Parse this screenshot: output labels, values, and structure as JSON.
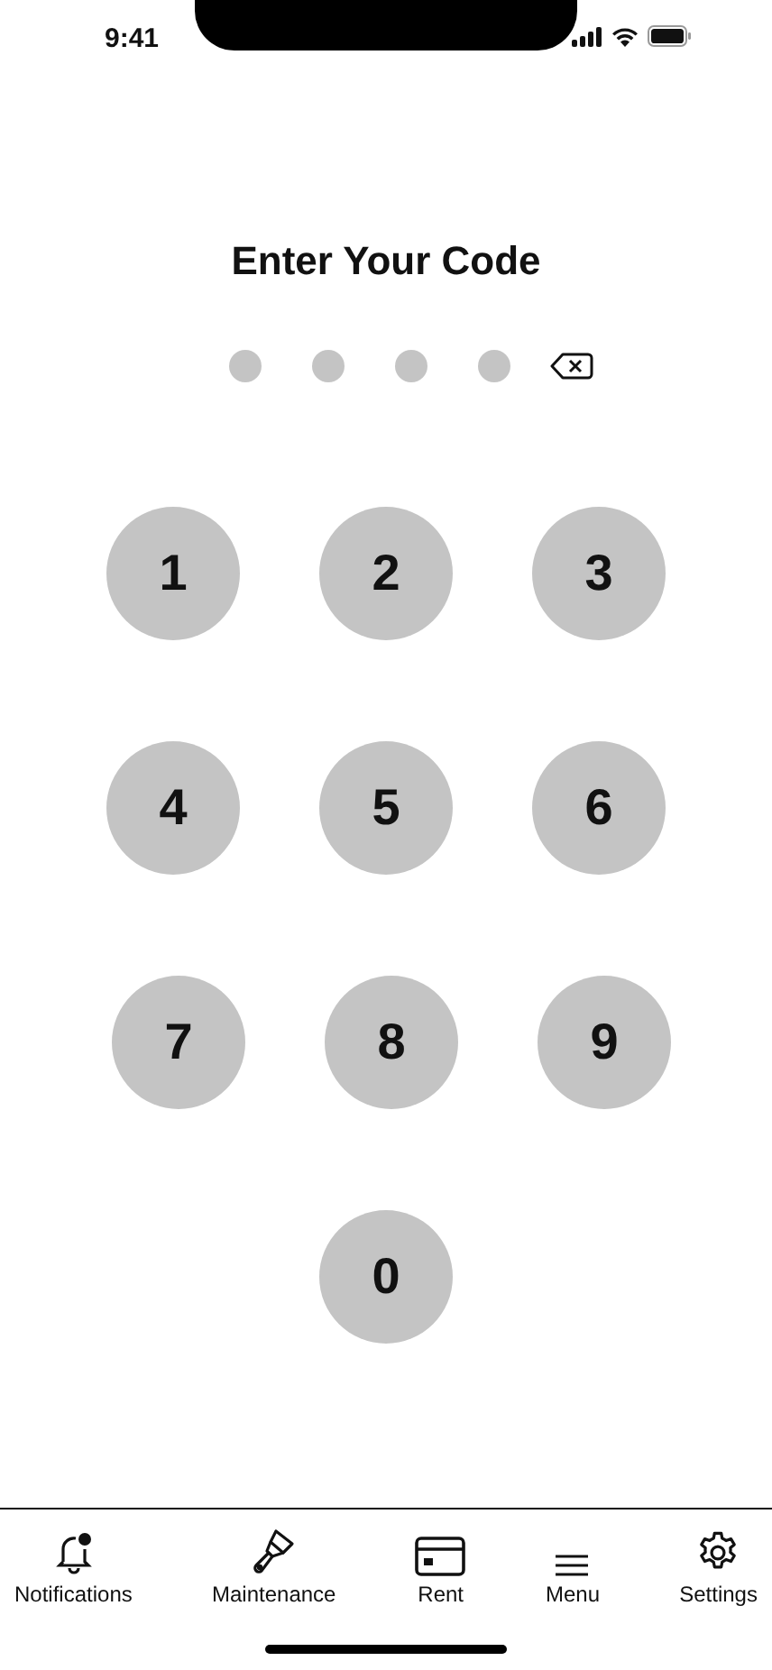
{
  "status_bar": {
    "time": "9:41"
  },
  "title": "Enter Your Code",
  "code_dots": [
    {
      "filled": false
    },
    {
      "filled": false
    },
    {
      "filled": false
    },
    {
      "filled": false
    }
  ],
  "keypad": [
    [
      "1",
      "2",
      "3"
    ],
    [
      "4",
      "5",
      "6"
    ],
    [
      "7",
      "8",
      "9"
    ],
    [
      "0"
    ]
  ],
  "nav": [
    {
      "kind": "bell",
      "label": "Notifications"
    },
    {
      "kind": "brush",
      "label": "Maintenance"
    },
    {
      "kind": "card",
      "label": "Rent"
    },
    {
      "kind": "menu",
      "label": "Menu"
    },
    {
      "kind": "gear",
      "label": "Settings"
    }
  ]
}
